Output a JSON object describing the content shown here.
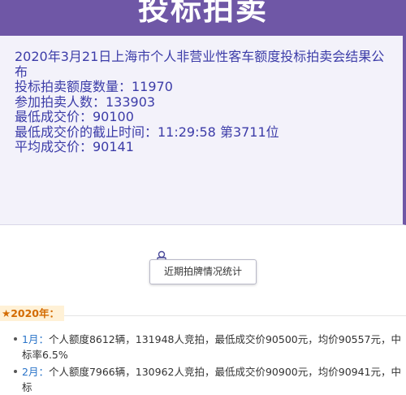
{
  "header": {
    "title": "投标拍卖"
  },
  "result": {
    "lines": [
      "2020年3月21日上海市个人非营业性客车额度投标拍卖会结果公布",
      "投标拍卖额度数量：11970",
      "参加拍卖人数：133903",
      "最低成交价：90100",
      "最低成交价的截止时间：11:29:58 第3711位",
      "平均成交价：90141"
    ]
  },
  "stats": {
    "button_label": "近期拍牌情况统计",
    "icon": "chart-bar-icon"
  },
  "year_section": {
    "label": "★2020年："
  },
  "months": [
    {
      "month": "1月：",
      "text": "个人额度8612辆，131948人竞拍，最低成交价90500元，均价90557元，中标率6.5%"
    },
    {
      "month": "2月：",
      "text": "个人额度7966辆，130962人竞拍，最低成交价90900元，均价90941元，中标"
    }
  ],
  "colors": {
    "header": "#6f57a6",
    "result_text": "#3c3ca8",
    "year_badge": "#d36b00",
    "month_link": "#2a74c9"
  }
}
